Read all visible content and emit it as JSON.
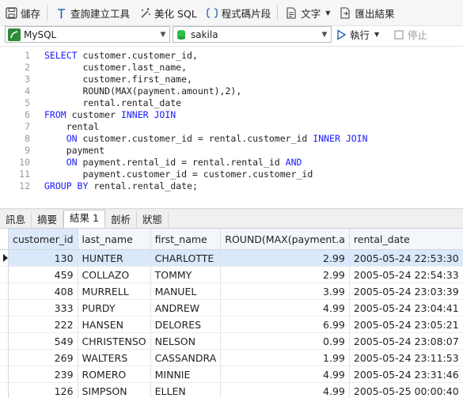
{
  "toolbar": {
    "save": "儲存",
    "query_builder": "查詢建立工具",
    "beautify": "美化 SQL",
    "snippet": "程式碼片段",
    "text": "文字",
    "export": "匯出結果"
  },
  "connection": {
    "name": "MySQL",
    "database": "sakila"
  },
  "run": {
    "label": "執行",
    "stop": "停止"
  },
  "editor": {
    "lines": [
      {
        "n": "1",
        "t": "SELECT customer.customer_id,"
      },
      {
        "n": "2",
        "t": "       customer.last_name,"
      },
      {
        "n": "3",
        "t": "       customer.first_name,"
      },
      {
        "n": "4",
        "t": "       ROUND(MAX(payment.amount),2),"
      },
      {
        "n": "5",
        "t": "       rental.rental_date"
      },
      {
        "n": "6",
        "t": "FROM customer INNER JOIN"
      },
      {
        "n": "7",
        "t": "    rental"
      },
      {
        "n": "8",
        "t": "    ON customer.customer_id = rental.customer_id INNER JOIN"
      },
      {
        "n": "9",
        "t": "    payment"
      },
      {
        "n": "10",
        "t": "    ON payment.rental_id = rental.rental_id AND"
      },
      {
        "n": "11",
        "t": "       payment.customer_id = customer.customer_id"
      },
      {
        "n": "12",
        "t": "GROUP BY rental.rental_date;"
      }
    ]
  },
  "result_tabs": [
    "訊息",
    "摘要",
    "結果 1",
    "剖析",
    "狀態"
  ],
  "grid": {
    "columns": [
      "customer_id",
      "last_name",
      "first_name",
      "ROUND(MAX(payment.a",
      "rental_date"
    ],
    "rows": [
      [
        "130",
        "HUNTER",
        "CHARLOTTE",
        "2.99",
        "2005-05-24 22:53:30"
      ],
      [
        "459",
        "COLLAZO",
        "TOMMY",
        "2.99",
        "2005-05-24 22:54:33"
      ],
      [
        "408",
        "MURRELL",
        "MANUEL",
        "3.99",
        "2005-05-24 23:03:39"
      ],
      [
        "333",
        "PURDY",
        "ANDREW",
        "4.99",
        "2005-05-24 23:04:41"
      ],
      [
        "222",
        "HANSEN",
        "DELORES",
        "6.99",
        "2005-05-24 23:05:21"
      ],
      [
        "549",
        "CHRISTENSO",
        "NELSON",
        "0.99",
        "2005-05-24 23:08:07"
      ],
      [
        "269",
        "WALTERS",
        "CASSANDRA",
        "1.99",
        "2005-05-24 23:11:53"
      ],
      [
        "239",
        "ROMERO",
        "MINNIE",
        "4.99",
        "2005-05-24 23:31:46"
      ],
      [
        "126",
        "SIMPSON",
        "ELLEN",
        "4.99",
        "2005-05-25 00:00:40"
      ]
    ]
  }
}
